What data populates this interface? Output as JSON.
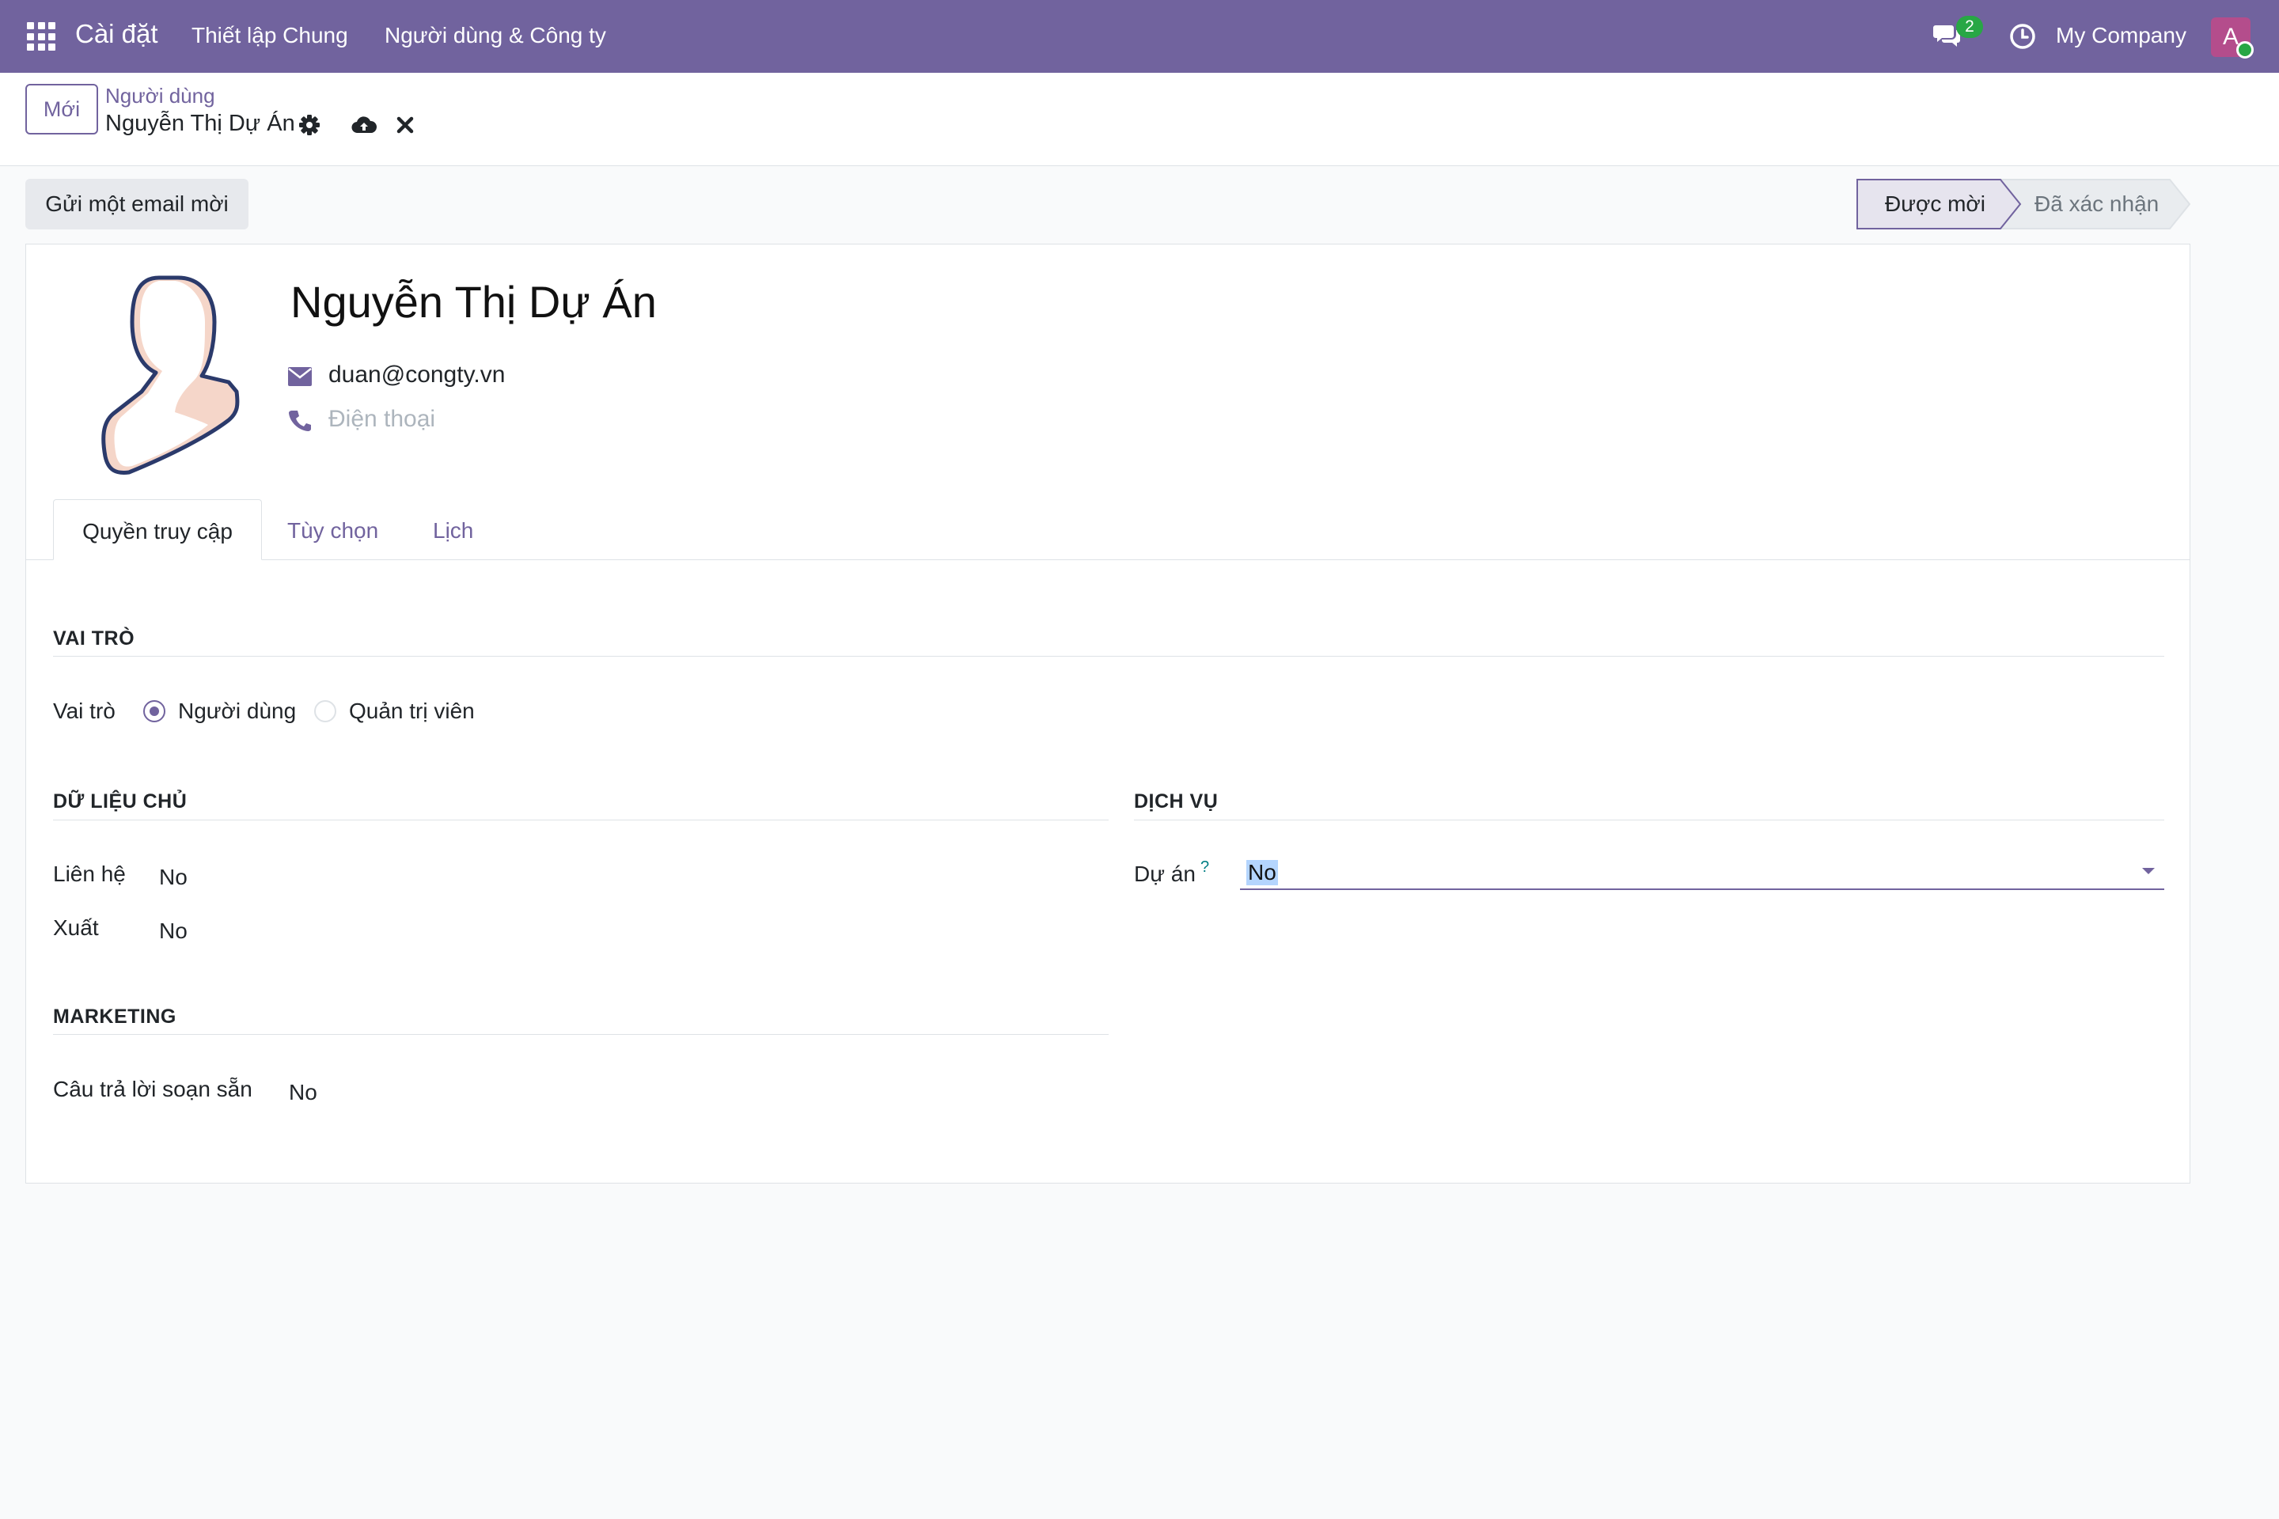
{
  "navbar": {
    "app_name": "Cài đặt",
    "menus": [
      "Thiết lập Chung",
      "Người dùng & Công ty"
    ],
    "chat_count": "2",
    "company": "My Company",
    "avatar_letter": "A",
    "colors": {
      "bar": "#71639e",
      "badge": "#28a745",
      "avatar": "#b44d8c"
    }
  },
  "control_panel": {
    "new_label": "Mới",
    "breadcrumb_parent": "Người dùng",
    "breadcrumb_current": "Nguyễn Thị Dự Án",
    "icons": [
      "gear-icon",
      "cloud-upload-icon",
      "discard-icon"
    ]
  },
  "statusbar": {
    "invite_label": "Gửi một email mời",
    "stages": [
      {
        "label": "Được mời",
        "active": true
      },
      {
        "label": "Đã xác nhận",
        "active": false
      }
    ]
  },
  "profile": {
    "name": "Nguyễn Thị Dự Án",
    "email": "duan@congty.vn",
    "phone_placeholder": "Điện thoại"
  },
  "tabs": [
    {
      "label": "Quyền truy cập",
      "active": true
    },
    {
      "label": "Tùy chọn",
      "active": false
    },
    {
      "label": "Lịch",
      "active": false
    }
  ],
  "access": {
    "role_section": "VAI TRÒ",
    "role_label": "Vai trò",
    "role_options": [
      {
        "label": "Người dùng",
        "checked": true
      },
      {
        "label": "Quản trị viên",
        "checked": false
      }
    ],
    "master_data_section": "DỮ LIỆU CHỦ",
    "master_data_fields": [
      {
        "label": "Liên hệ",
        "value": "No"
      },
      {
        "label": "Xuất",
        "value": "No"
      }
    ],
    "services_section": "DỊCH VỤ",
    "project_label": "Dự án",
    "project_help": "?",
    "project_value": "No",
    "marketing_section": "MARKETING",
    "canned_label": "Câu trả lời soạn sẵn",
    "canned_value": "No"
  }
}
